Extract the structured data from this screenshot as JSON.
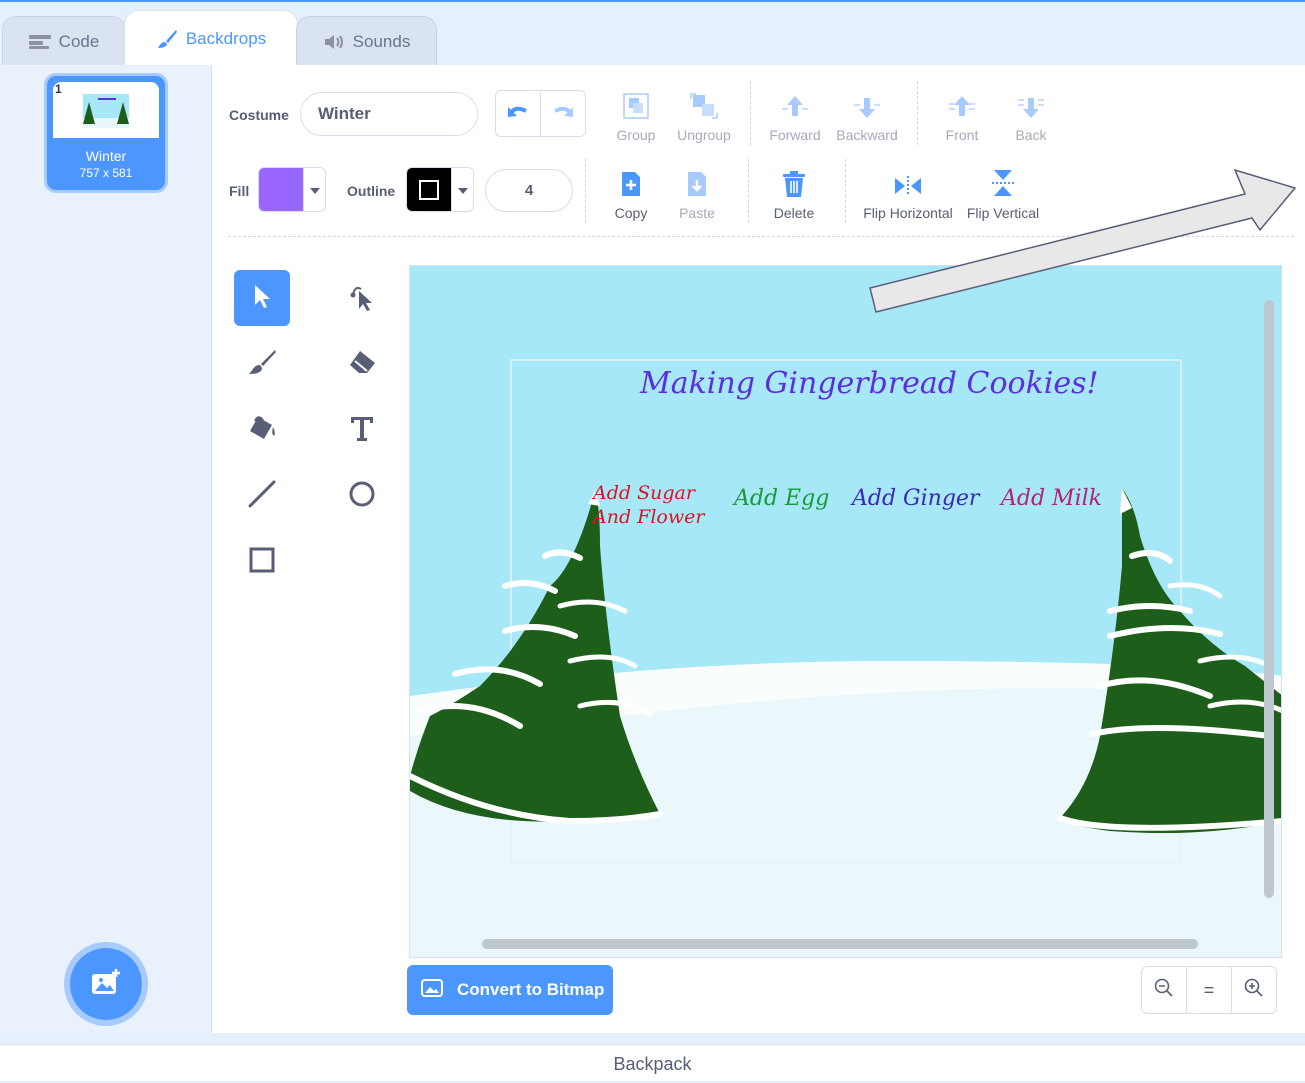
{
  "tabs": [
    {
      "label": "Code",
      "icon": "code-icon",
      "active": false
    },
    {
      "label": "Backdrops",
      "icon": "brush-icon",
      "active": true
    },
    {
      "label": "Sounds",
      "icon": "speaker-icon",
      "active": false
    }
  ],
  "backdrop_list": {
    "items": [
      {
        "number": "1",
        "name": "Winter",
        "size": "757 x 581",
        "selected": true
      }
    ],
    "add_button_icon": "add-backdrop-icon"
  },
  "toolbar": {
    "costume_label": "Costume",
    "costume_name": "Winter",
    "fill_label": "Fill",
    "fill_color": "#9966ff",
    "outline_label": "Outline",
    "outline_color": "#000000",
    "outline_width": "4",
    "group": "Group",
    "ungroup": "Ungroup",
    "forward": "Forward",
    "backward": "Backward",
    "front": "Front",
    "back": "Back",
    "copy": "Copy",
    "paste": "Paste",
    "delete": "Delete",
    "flip_horizontal": "Flip Horizontal",
    "flip_vertical": "Flip Vertical"
  },
  "tools": [
    "select",
    "reshape",
    "brush",
    "eraser",
    "fill",
    "text",
    "line",
    "circle",
    "rectangle"
  ],
  "canvas": {
    "title": "Making Gingerbread Cookies!",
    "labels": [
      "Add Sugar And Flower",
      "Add Egg",
      "Add Ginger",
      "Add Milk"
    ]
  },
  "convert_button": "Convert to Bitmap",
  "zoom": {
    "out": "zoom-out-icon",
    "reset": "=",
    "in": "zoom-in-icon"
  },
  "backpack": "Backpack",
  "colors": {
    "accent": "#4c97ff",
    "sky": "#a7e8f8",
    "tree": "#1d5e1a"
  }
}
